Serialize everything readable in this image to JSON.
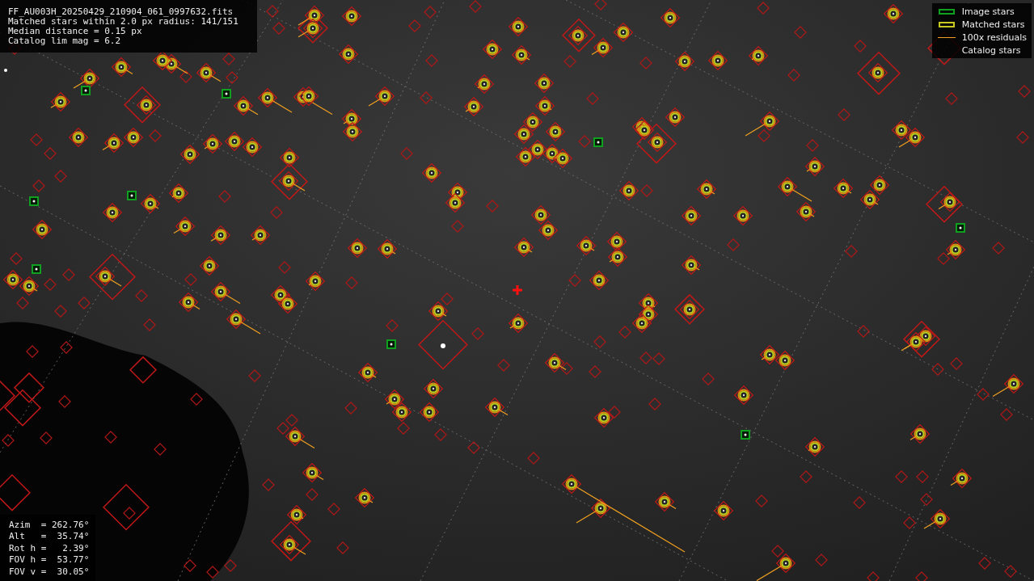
{
  "file_info": [
    "FF_AU003H_20250429_210904_061_0997632.fits",
    "Matched stars within 2.0 px radius: 141/151",
    "Median distance = 0.15 px",
    "Catalog lim mag = 6.2"
  ],
  "legend": [
    {
      "kind": "image",
      "label": "Image stars"
    },
    {
      "kind": "matched",
      "label": "Matched stars"
    },
    {
      "kind": "residual",
      "label": "100x residuals"
    },
    {
      "kind": "catalog",
      "label": "Catalog stars"
    }
  ],
  "pointing": [
    "Azim  = 262.76°",
    "Alt   =  35.74°",
    "Rot h =   2.39°",
    "FOV h =  53.77°",
    "FOV v =  30.05°"
  ]
}
